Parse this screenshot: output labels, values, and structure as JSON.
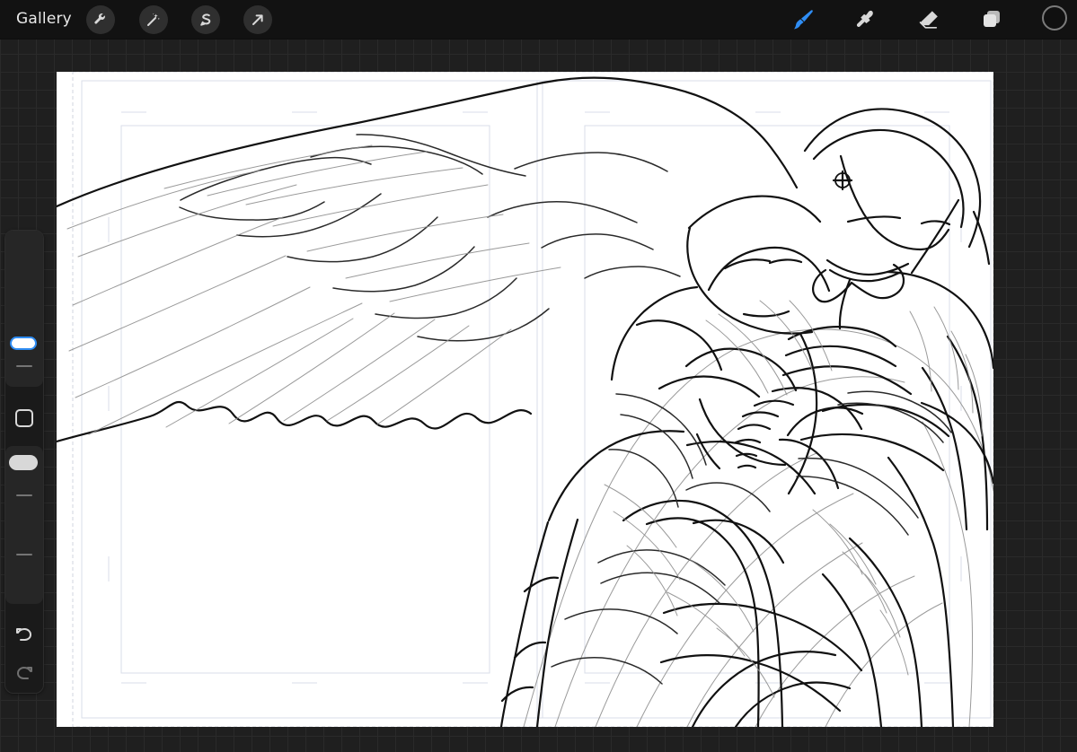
{
  "topbar": {
    "gallery_label": "Gallery",
    "tools_left": [
      {
        "name": "wrench-icon"
      },
      {
        "name": "magic-wand-icon"
      },
      {
        "name": "selection-icon"
      },
      {
        "name": "transform-arrow-icon"
      }
    ],
    "tools_right": [
      {
        "name": "brush-icon",
        "color": "#2f8df4"
      },
      {
        "name": "smudge-icon",
        "color": "#d9d9d9"
      },
      {
        "name": "eraser-icon",
        "color": "#d9d9d9"
      },
      {
        "name": "layers-icon",
        "color": "#d9d9d9"
      }
    ],
    "current_color": "#101010",
    "swatch_border": "#7b7b7b"
  },
  "sidebar": {
    "brush_size_level": 0.76,
    "opacity_level": 0.86,
    "controls": [
      {
        "name": "modify-button-icon"
      },
      {
        "name": "undo-icon"
      },
      {
        "name": "redo-icon"
      }
    ],
    "accent": "#2f8df4"
  },
  "canvas": {
    "background": "#ffffff",
    "ink_color": "#111111",
    "guide_color": "#d8dee8"
  }
}
